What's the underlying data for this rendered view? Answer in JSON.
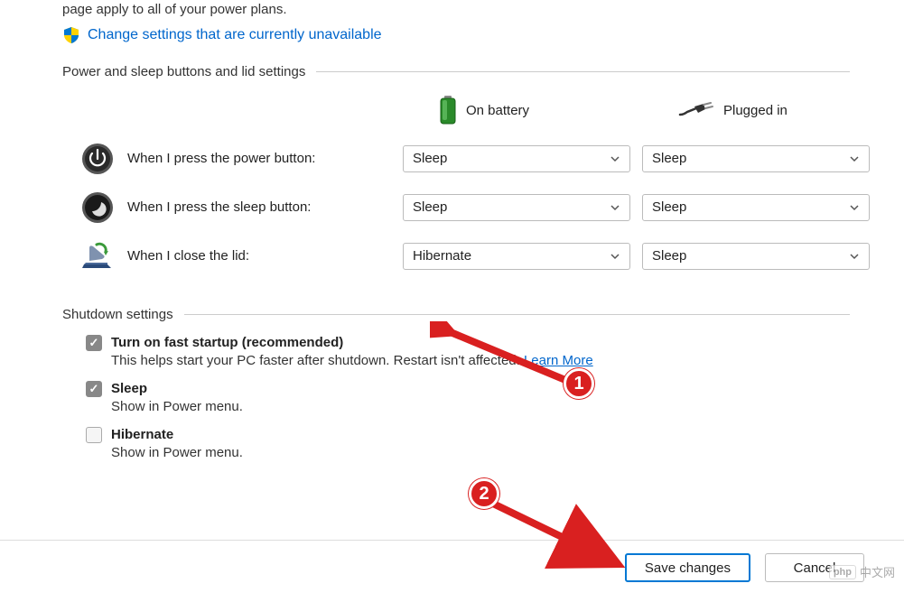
{
  "intro_line": "page apply to all of your power plans.",
  "change_link": "Change settings that are currently unavailable",
  "section_power": "Power and sleep buttons and lid settings",
  "col_battery": "On battery",
  "col_plugged": "Plugged in",
  "rows": [
    {
      "label": "When I press the power button:",
      "battery": "Sleep",
      "plugged": "Sleep"
    },
    {
      "label": "When I press the sleep button:",
      "battery": "Sleep",
      "plugged": "Sleep"
    },
    {
      "label": "When I close the lid:",
      "battery": "Hibernate",
      "plugged": "Sleep"
    }
  ],
  "section_shutdown": "Shutdown settings",
  "shutdown_items": [
    {
      "label": "Turn on fast startup (recommended)",
      "desc_pre": "This helps start your PC faster after shutdown. Restart isn't affected. ",
      "learn": "Learn More",
      "checked": true
    },
    {
      "label": "Sleep",
      "desc": "Show in Power menu.",
      "checked": true
    },
    {
      "label": "Hibernate",
      "desc": "Show in Power menu.",
      "checked": false
    }
  ],
  "save_btn": "Save changes",
  "cancel_btn": "Cancel",
  "step1": "1",
  "step2": "2",
  "watermark": "中文网"
}
